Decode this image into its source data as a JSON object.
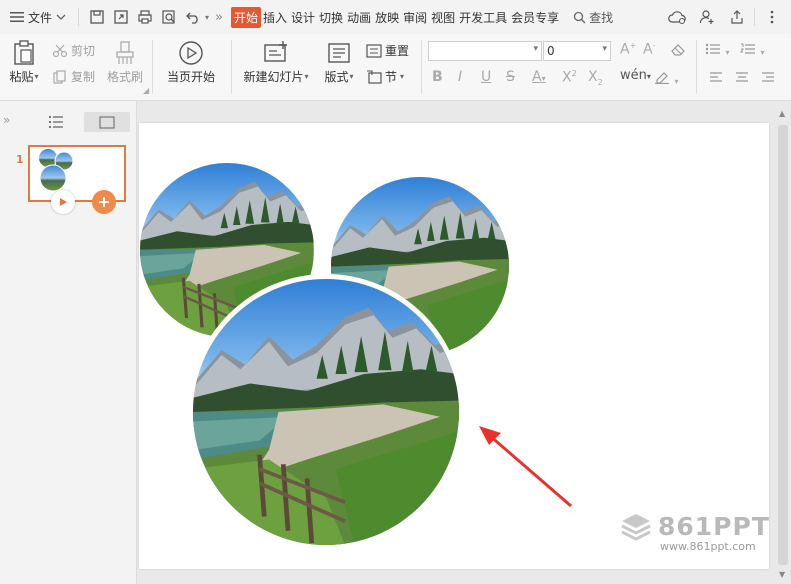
{
  "menubar": {
    "file_label": "文件",
    "tabs": [
      "开始",
      "插入",
      "设计",
      "切换",
      "动画",
      "放映",
      "审阅",
      "视图",
      "开发工具",
      "会员专享"
    ],
    "active_tab": "开始",
    "search_label": "查找"
  },
  "ribbon": {
    "paste": "粘贴",
    "cut": "剪切",
    "copy": "复制",
    "format_painter": "格式刷",
    "play_from_current": "当页开始",
    "new_slide": "新建幻灯片",
    "layout": "版式",
    "reset": "重置",
    "section": "节",
    "font_name_value": "",
    "font_size_value": "0"
  },
  "slides_panel": {
    "slide_number": "1"
  },
  "watermark": {
    "brand": "861PPT",
    "url": "www.861ppt.com"
  },
  "colors": {
    "accent": "#e65733",
    "thumb_border": "#e07a3f",
    "arrow": "#e8322b"
  }
}
